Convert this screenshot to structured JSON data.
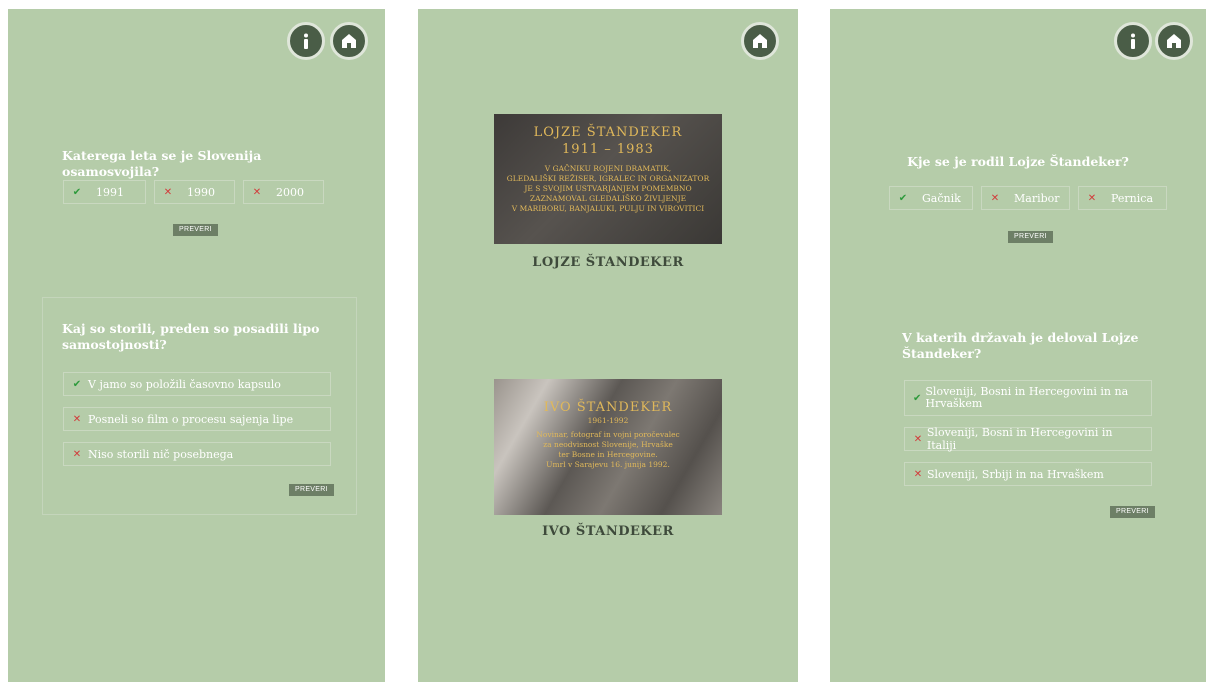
{
  "screens": {
    "s1": {
      "q1": {
        "question": "Katerega leta se je Slovenija osamosvojila?",
        "options": [
          {
            "label": "1991",
            "mark": "✔"
          },
          {
            "label": "1990",
            "mark": "✕"
          },
          {
            "label": "2000",
            "mark": "✕"
          }
        ],
        "check_label": "PREVERI"
      },
      "q2": {
        "question": "Kaj so storili, preden so posadili lipo samostojnosti?",
        "options": [
          {
            "label": "V jamo so položili časovno kapsulo",
            "mark": "✔"
          },
          {
            "label": "Posneli so film o procesu sajenja lipe",
            "mark": "✕"
          },
          {
            "label": "Niso storili nič posebnega",
            "mark": "✕"
          }
        ],
        "check_label": "PREVERI"
      }
    },
    "s2": {
      "plaque1": {
        "name": "LOJZE ŠTANDEKER",
        "years": "1911 – 1983",
        "lines": [
          "V GAČNIKU ROJENI DRAMATIK,",
          "GLEDALIŠKI REŽISER, IGRALEC IN ORGANIZATOR",
          "JE S SVOJIM USTVARJANJEM POMEMBNO",
          "ZAZNAMOVAL GLEDALIŠKO ŽIVLJENJE",
          "V MARIBORU, BANJALUKI, PULJU IN VIROVITICI"
        ],
        "caption": "LOJZE ŠTANDEKER"
      },
      "plaque2": {
        "name": "IVO ŠTANDEKER",
        "years": "1961-1992",
        "lines": [
          "Novinar, fotograf in vojni poročevalec",
          "za neodvisnost Slovenije, Hrvaške",
          "ter Bosne in Hercegovine.",
          "Umrl v Sarajevu 16. junija 1992."
        ],
        "caption": "IVO ŠTANDEKER"
      }
    },
    "s3": {
      "q1": {
        "question": "Kje se je rodil Lojze Štandeker?",
        "options": [
          {
            "label": "Gačnik",
            "mark": "✔"
          },
          {
            "label": "Maribor",
            "mark": "✕"
          },
          {
            "label": "Pernica",
            "mark": "✕"
          }
        ],
        "check_label": "PREVERI"
      },
      "q2": {
        "question": "V katerih državah je deloval Lojze Štandeker?",
        "options": [
          {
            "label": "Sloveniji, Bosni in Hercegovini in na Hrvaškem",
            "mark": "✔"
          },
          {
            "label": "Sloveniji, Bosni in Hercegovini in Italiji",
            "mark": "✕"
          },
          {
            "label": "Sloveniji, Srbiji in na Hrvaškem",
            "mark": "✕"
          }
        ],
        "check_label": "PREVERI"
      }
    }
  },
  "icons": {
    "info": "info-icon",
    "home": "home-icon"
  },
  "colors": {
    "background": "#b5cca9",
    "button": "#4a5d47",
    "correct": "#2e9a3c",
    "wrong": "#d23a3a",
    "check_button": "#6d7f66"
  }
}
